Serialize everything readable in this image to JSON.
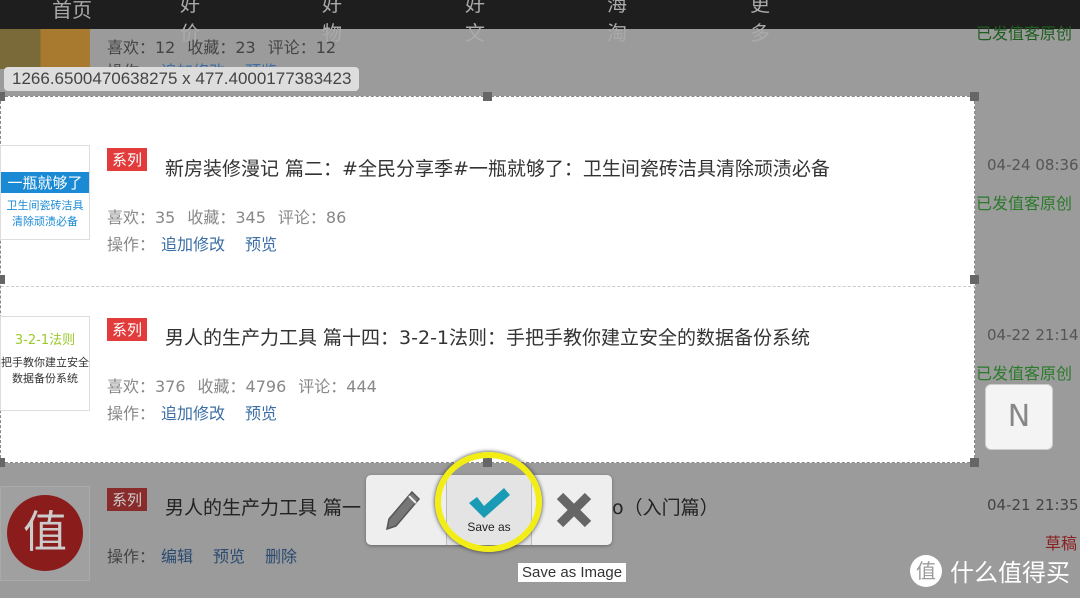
{
  "nav": {
    "items": [
      {
        "label": "首页"
      },
      {
        "label": "好价"
      },
      {
        "label": "好物"
      },
      {
        "label": "好文"
      },
      {
        "label": "海淘"
      },
      {
        "label": "更多"
      }
    ]
  },
  "capture": {
    "size_readout": "1266.6500470638275 x 477.4000177383423"
  },
  "rows": [
    {
      "stats": {
        "likes": "喜欢：12",
        "favs": "收藏：23",
        "comments": "评论：12"
      },
      "ops_label": "操作：",
      "ops": [
        "追加修改",
        "预览"
      ],
      "status": "已发值客原创"
    },
    {
      "thumb": [
        "一瓶就够了",
        "卫生间瓷砖洁具",
        "清除顽渍必备"
      ],
      "tag": "系列",
      "title": "新房装修漫记 篇二：#全民分享季#一瓶就够了：卫生间瓷砖洁具清除顽渍必备",
      "stats": {
        "likes": "喜欢：35",
        "favs": "收藏：345",
        "comments": "评论：86"
      },
      "ops_label": "操作：",
      "ops": [
        "追加修改",
        "预览"
      ],
      "date": "04-24 08:36",
      "status": "已发值客原创"
    },
    {
      "thumb": [
        "3-2-1法则",
        "把手教你建立安全",
        "数据备份系统"
      ],
      "tag": "系列",
      "title": "男人的生产力工具 篇十四：3-2-1法则：手把手教你建立安全的数据备份系统",
      "stats": {
        "likes": "喜欢：376",
        "favs": "收藏：4796",
        "comments": "评论：444"
      },
      "ops_label": "操作：",
      "ops": [
        "追加修改",
        "预览"
      ],
      "date": "04-22 21:14",
      "status": "已发值客原创"
    },
    {
      "thumb": [
        "值"
      ],
      "tag": "系列",
      "title_start": "男人的生产力工具 篇一",
      "title_end": "o（入门篇）",
      "ops_label": "操作：",
      "ops": [
        "编辑",
        "预览",
        "删除"
      ],
      "date": "04-21 21:35",
      "status": "草稿"
    }
  ],
  "toolbar": {
    "edit_icon": "pencil-icon",
    "save_label": "Save as",
    "save_icon": "checkmark-icon",
    "cancel_icon": "x-icon",
    "tooltip": "Save as Image",
    "accent": "#1a9bb5",
    "highlight": "#f2ee15"
  },
  "side_button": {
    "label": "N"
  },
  "watermark": {
    "glyph": "值",
    "text": "什么值得买"
  }
}
